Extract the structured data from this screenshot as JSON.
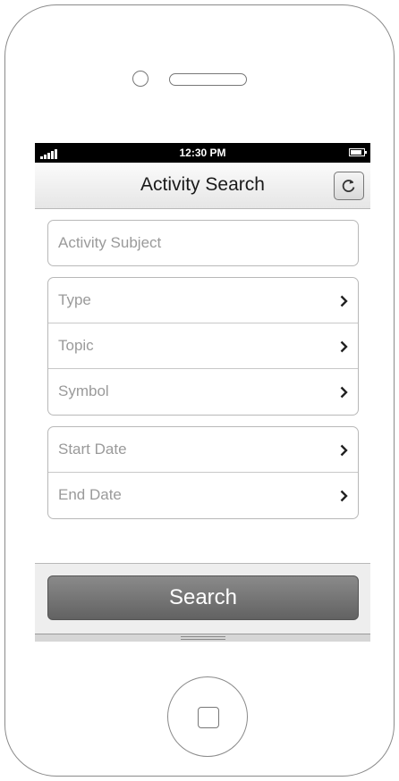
{
  "status_bar": {
    "time": "12:30 PM",
    "signal_icon": "signal-bars-icon",
    "battery_icon": "battery-icon"
  },
  "nav_bar": {
    "title": "Activity Search",
    "refresh_icon": "refresh-icon"
  },
  "form": {
    "subject": {
      "placeholder": "Activity Subject",
      "value": ""
    },
    "group1": [
      {
        "label": "Type"
      },
      {
        "label": "Topic"
      },
      {
        "label": "Symbol"
      }
    ],
    "group2": [
      {
        "label": "Start Date"
      },
      {
        "label": "End Date"
      }
    ],
    "chevron_icon": "chevron-right-icon"
  },
  "toolbar": {
    "search_label": "Search"
  },
  "colors": {
    "status_bar": "#000000",
    "search_button": "#6f6f6f",
    "placeholder_text": "#9a9a9a"
  }
}
